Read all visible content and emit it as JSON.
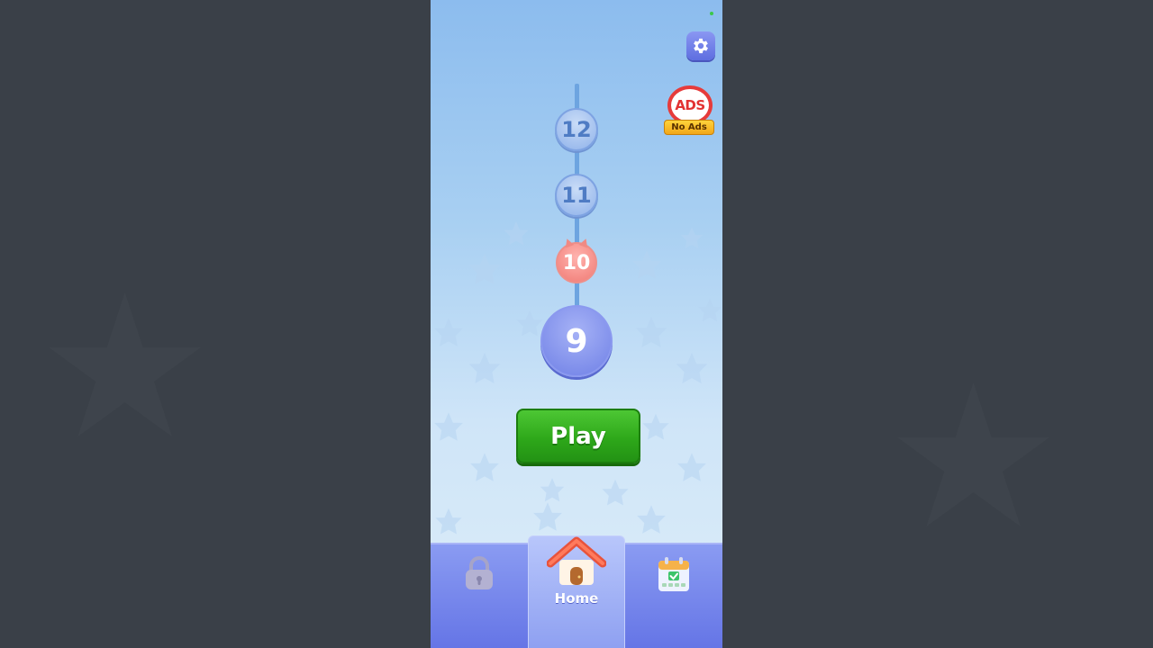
{
  "screen": "level-map",
  "levels": [
    {
      "number": "12",
      "state": "locked"
    },
    {
      "number": "11",
      "state": "locked"
    },
    {
      "number": "10",
      "state": "hard"
    },
    {
      "number": "9",
      "state": "current"
    }
  ],
  "top_right": {
    "settings_icon": "gear-icon",
    "no_ads_badge": "ADS",
    "no_ads_label": "No Ads"
  },
  "play_button": {
    "label": "Play"
  },
  "bottom_nav": {
    "tabs": [
      {
        "name": "locked",
        "icon": "padlock-icon",
        "label": ""
      },
      {
        "name": "home",
        "icon": "house-icon",
        "label": "Home",
        "active": true
      },
      {
        "name": "daily",
        "icon": "calendar-icon",
        "label": ""
      }
    ]
  },
  "colors": {
    "play_green": "#2ea81a",
    "current_level": "#6f80e6",
    "hard_level": "#f07a74",
    "locked_level": "#8fb2ea",
    "nav_bar": "#7585ea"
  }
}
